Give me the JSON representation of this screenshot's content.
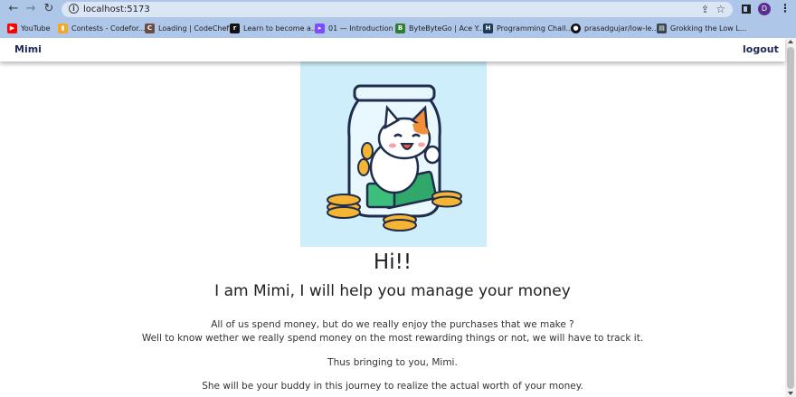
{
  "browser": {
    "url": "localhost:5173",
    "profile_initial": "D",
    "bookmarks": [
      {
        "label": "YouTube",
        "icon": "youtube-icon",
        "color": "#ff0000"
      },
      {
        "label": "Contests - Codefor...",
        "icon": "codeforces-icon",
        "color": "#f5a623"
      },
      {
        "label": "Loading | CodeChef",
        "icon": "codechef-icon",
        "color": "#6d4c41"
      },
      {
        "label": "Learn to become a...",
        "icon": "learn-icon",
        "color": "#111111"
      },
      {
        "label": "01 — Introduction",
        "icon": "play-icon",
        "color": "#7c4dff"
      },
      {
        "label": "ByteByteGo | Ace Y...",
        "icon": "bytebytego-icon",
        "color": "#2e7d32"
      },
      {
        "label": "Programming Chall...",
        "icon": "hackerrank-icon",
        "color": "#1c3b57"
      },
      {
        "label": "prasadgujar/low-le...",
        "icon": "github-icon",
        "color": "#111111"
      },
      {
        "label": "Grokking the Low L...",
        "icon": "grokking-icon",
        "color": "#37474f"
      }
    ]
  },
  "navbar": {
    "brand": "Mimi",
    "logout_label": "logout"
  },
  "hero": {
    "image_alt": "cat-in-money-jar-illustration",
    "title": "Hi!!",
    "subtitle": "I am Mimi, I will help you manage your money",
    "paragraph_1": "All of us spend money, but do we really enjoy the purchases that we make ?",
    "paragraph_2": "Well to know wether we really spend money on the most rewarding things or not, we will have to track it.",
    "paragraph_3": "Thus bringing to you, Mimi.",
    "paragraph_4": "She will be your buddy in this journey to realize the actual worth of your money."
  },
  "colors": {
    "chrome": "#aec7e8",
    "navbar_text": "#1e2a55",
    "hero_bg": "#cdeefa"
  }
}
